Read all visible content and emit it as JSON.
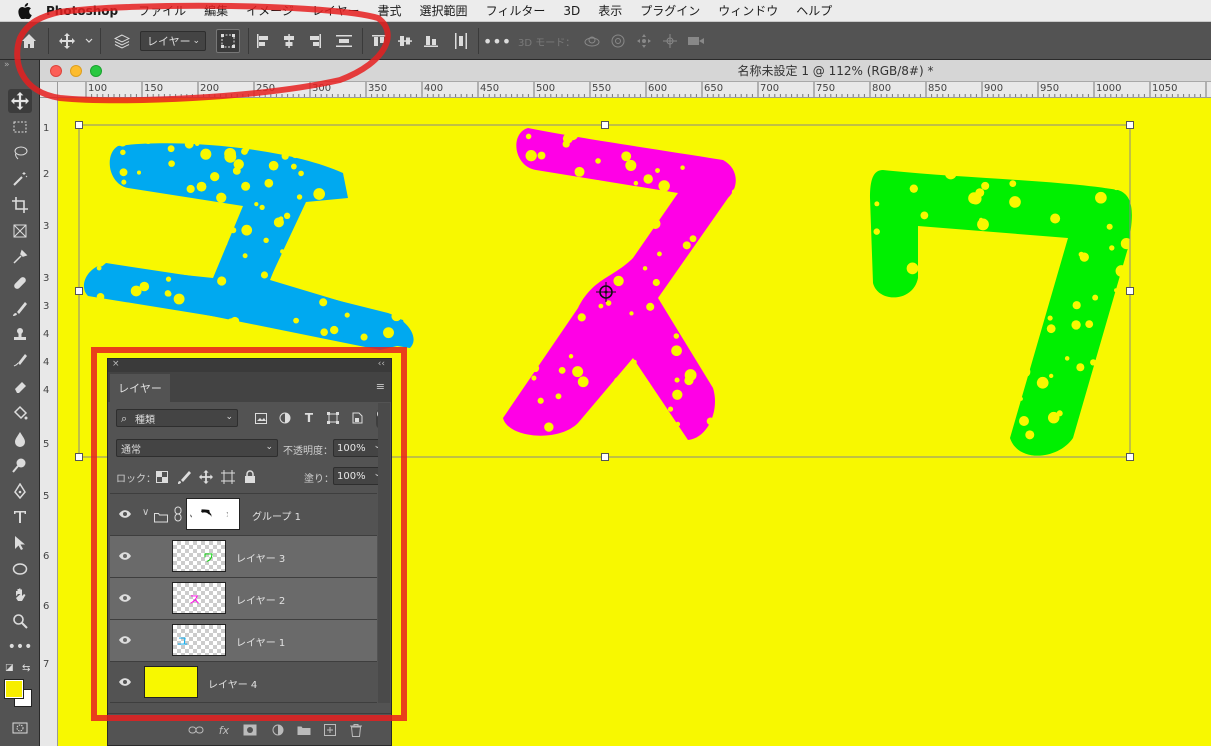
{
  "menubar": {
    "app": "Photoshop",
    "items": [
      "ファイル",
      "編集",
      "イメージ",
      "レイヤー",
      "書式",
      "選択範囲",
      "フィルター",
      "3D",
      "表示",
      "プラグイン",
      "ウィンドウ",
      "ヘルプ"
    ]
  },
  "options": {
    "target_select": "レイヤー",
    "threed_mode_label": "3D モード："
  },
  "document": {
    "title": "名称未設定 1 @ 112% (RGB/8#) *",
    "canvas_color": "#f8f800"
  },
  "ruler": {
    "top_labels": [
      "100",
      "150",
      "200",
      "250",
      "300",
      "350",
      "400",
      "450",
      "500",
      "550",
      "600",
      "650",
      "700",
      "750",
      "800",
      "850",
      "900",
      "950",
      "1000",
      "1050"
    ],
    "left_labels": [
      "1",
      "2",
      "3",
      "3",
      "3",
      "4",
      "4",
      "4",
      "5",
      "5",
      "6",
      "6",
      "7"
    ]
  },
  "canvas_text": {
    "chars": [
      "ユ",
      "ス",
      "ワ"
    ],
    "colors": [
      "#00a9f0",
      "#ff00e6",
      "#00f000"
    ]
  },
  "layers_panel": {
    "tab": "レイヤー",
    "filter": "種類",
    "blend_mode": "通常",
    "opacity_label": "不透明度：",
    "opacity": "100%",
    "lock_label": "ロック：",
    "fill_label": "塗り：",
    "fill": "100%",
    "group": {
      "name": "グループ 1"
    },
    "layers": [
      {
        "name": "レイヤー 3",
        "glyph": "ワ",
        "glyph_color": "#00d000"
      },
      {
        "name": "レイヤー 2",
        "glyph": "ス",
        "glyph_color": "#ff00e6"
      },
      {
        "name": "レイヤー 1",
        "glyph": "ユ",
        "glyph_color": "#00a9f0"
      }
    ],
    "background_layer": {
      "name": "レイヤー 4",
      "color": "#f8f800"
    }
  },
  "colors": {
    "foreground": "#f7ee00",
    "background": "#ffffff",
    "annotation": "#e62020"
  },
  "icons": {
    "apple": "apple-logo-icon",
    "tools": [
      "move-icon",
      "marquee-icon",
      "lasso-icon",
      "magic-wand-icon",
      "crop-icon",
      "frame-icon",
      "eyedropper-icon",
      "healing-brush-icon",
      "brush-icon",
      "clone-stamp-icon",
      "history-brush-icon",
      "eraser-icon",
      "paint-bucket-icon",
      "blur-icon",
      "dodge-icon",
      "pen-icon",
      "type-icon",
      "path-selection-icon",
      "ellipse-icon",
      "hand-icon",
      "zoom-icon",
      "more-tools-icon",
      "quick-mask-icon"
    ]
  }
}
